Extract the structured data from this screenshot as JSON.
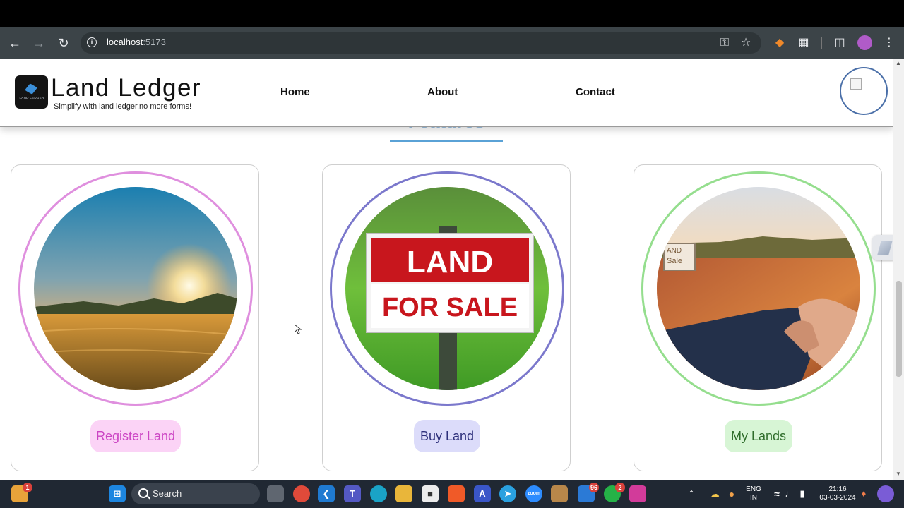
{
  "browser": {
    "url_host": "localhost",
    "url_port": ":5173",
    "back_icon": "arrow-left-icon",
    "forward_icon": "arrow-right-icon",
    "reload_icon": "reload-icon",
    "site_info_icon": "info-icon",
    "key_icon": "key-icon",
    "star_icon": "star-icon",
    "metamask_icon": "fox-extension-icon",
    "extensions_icon": "puzzle-icon",
    "sidepanel_icon": "side-panel-icon",
    "menu_icon": "kebab-menu-icon"
  },
  "header": {
    "logo_mini_text": "LAND LEDGER",
    "brand": "Land Ledger",
    "tagline": "Simplify with land ledger,no more forms!",
    "nav": [
      "Home",
      "About",
      "Contact"
    ]
  },
  "features_heading": "Features",
  "cards": [
    {
      "label": "Register Land",
      "ring_color": "#df8fde",
      "pill_bg": "#fbd3f6",
      "pill_color": "#cc45c4"
    },
    {
      "label": "Buy Land",
      "ring_color": "#7b78cc",
      "pill_bg": "#dcdcfa",
      "pill_color": "#2d2f7a"
    },
    {
      "label": "My Lands",
      "ring_color": "#95de8e",
      "pill_bg": "#d7f5d5",
      "pill_color": "#2f6d2b"
    }
  ],
  "sale_sign": {
    "line1": "LAND",
    "line2": "FOR SALE"
  },
  "small_sign_text": [
    "AND",
    "Sale"
  ],
  "taskbar": {
    "search_label": "Search",
    "notif_badge": "1",
    "app_badge_1": "96",
    "app_badge_2": "2",
    "lang_top": "ENG",
    "lang_bottom": "IN",
    "time": "21:16",
    "date": "03-03-2024"
  }
}
